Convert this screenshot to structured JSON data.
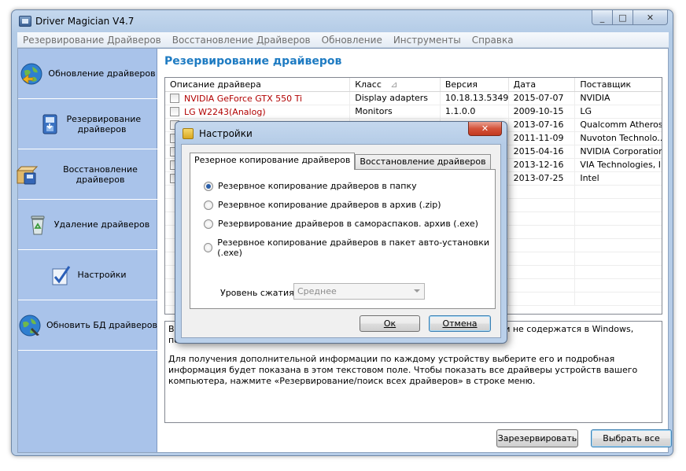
{
  "window": {
    "title": "Driver Magician V4.7",
    "controls": {
      "minimize": "_",
      "maximize": "□",
      "close": "✕"
    }
  },
  "menu": [
    "Резервирование Драйверов",
    "Восстановление Драйверов",
    "Обновление",
    "Инструменты",
    "Справка"
  ],
  "sidebar": {
    "items": [
      {
        "label": "Обновление драйверов",
        "icon": "globe-update-icon"
      },
      {
        "label": "Резервирование драйверов",
        "icon": "backup-disk-icon"
      },
      {
        "label": "Восстановление драйверов",
        "icon": "restore-box-icon"
      },
      {
        "label": "Удаление драйверов",
        "icon": "recycle-bin-icon"
      },
      {
        "label": "Настройки",
        "icon": "settings-check-icon"
      },
      {
        "label": "Обновить БД драйверов",
        "icon": "globe-refresh-icon"
      }
    ]
  },
  "main": {
    "section_title": "Резервирование драйверов",
    "columns": [
      "Описание драйвера",
      "Класс",
      "Версия",
      "Дата",
      "Поставщик"
    ],
    "sort_indicator": "⊿",
    "rows": [
      {
        "name": "NVIDIA GeForce GTX 550 Ti",
        "class": "Display adapters",
        "version": "10.18.13.5349",
        "date": "2015-07-07",
        "vendor": "NVIDIA",
        "highlight": true
      },
      {
        "name": "LG W2243(Analog)",
        "class": "Monitors",
        "version": "1.1.0.0",
        "date": "2009-10-15",
        "vendor": "LG",
        "highlight": true
      },
      {
        "name": "",
        "class": "",
        "version": "",
        "date": "2013-07-16",
        "vendor": "Qualcomm Atheros",
        "highlight": false
      },
      {
        "name": "",
        "class": "",
        "version": "",
        "date": "2011-11-09",
        "vendor": "Nuvoton Technolo...",
        "highlight": false
      },
      {
        "name": "",
        "class": "",
        "version": "",
        "date": "2015-04-16",
        "vendor": "NVIDIA Corporation",
        "highlight": false
      },
      {
        "name": "",
        "class": "",
        "version": "",
        "date": "2013-12-16",
        "vendor": "VIA Technologies, I...",
        "highlight": false
      },
      {
        "name": "",
        "class": "",
        "version": "",
        "date": "2013-07-25",
        "vendor": "Intel",
        "highlight": false
      }
    ],
    "info": {
      "line1_start": "Вы",
      "line1_end": "ни не содержатся в Windows,",
      "line2_start": "пос",
      "paragraph": "Для получения дополнительной информации по каждому устройству выберите его и подробная информация будет показана в этом текстовом поле. Чтобы показать все драйверы устройств вашего компьютера, нажмите «Резервирование/поиск всех драйверов» в строке меню."
    },
    "buttons": {
      "backup": "Зарезервировать",
      "select_all": "Выбрать все"
    }
  },
  "dialog": {
    "title": "Настройки",
    "close": "✕",
    "tabs": [
      "Резерное копирование драйверов",
      "Восстановление драйверов"
    ],
    "active_tab": 0,
    "options": [
      {
        "label": "Резервное копирование драйверов в папку",
        "selected": true
      },
      {
        "label": "Резервное копирование драйверов в архив (.zip)",
        "selected": false
      },
      {
        "label": "Резервирование драйверов в самораспаков. архив (.exe)",
        "selected": false
      },
      {
        "label": "Резервное копирование драйверов в пакет авто-установки (.exe)",
        "selected": false
      }
    ],
    "compression": {
      "label": "Уровень сжатия",
      "value": "Среднее"
    },
    "ok": "Ок",
    "cancel": "Отмена"
  },
  "colors": {
    "sidebar_bg": "#a9c3ea",
    "section_title": "#1e7bc2",
    "highlight_text": "#b10000",
    "radio_dot": "#2a5ea8"
  }
}
